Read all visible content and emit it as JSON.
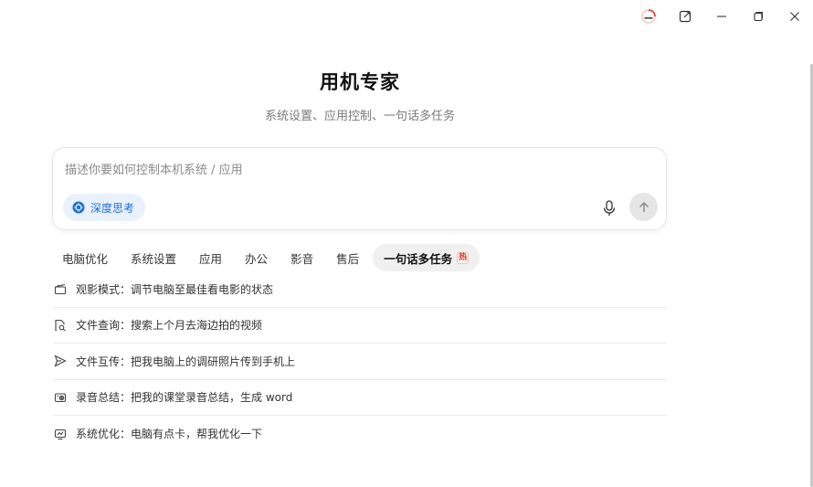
{
  "window": {
    "logo_icon": "app-logo-icon",
    "controls": [
      "pop-out-icon",
      "minimize-icon",
      "maximize-icon",
      "close-icon"
    ]
  },
  "header": {
    "title": "用机专家",
    "subtitle": "系统设置、应用控制、一句话多任务"
  },
  "input": {
    "placeholder": "描述你要如何控制本机系统 / 应用",
    "value": "",
    "deep_think_label": "深度思考",
    "accent": "#1f6fd6"
  },
  "tabs": [
    {
      "label": "电脑优化"
    },
    {
      "label": "系统设置"
    },
    {
      "label": "应用"
    },
    {
      "label": "办公"
    },
    {
      "label": "影音"
    },
    {
      "label": "售后"
    },
    {
      "label": "一句话多任务",
      "badge": "热",
      "active": true
    }
  ],
  "suggestions": [
    {
      "icon": "clapperboard-icon",
      "text": "观影模式：调节电脑至最佳看电影的状态"
    },
    {
      "icon": "file-search-icon",
      "text": "文件查询：搜索上个月去海边拍的视频"
    },
    {
      "icon": "send-icon",
      "text": "文件互传：把我电脑上的调研照片传到手机上"
    },
    {
      "icon": "recorder-icon",
      "text": "录音总结：把我的课堂录音总结，生成 word"
    },
    {
      "icon": "optimize-icon",
      "text": "系统优化：电脑有点卡，帮我优化一下"
    }
  ]
}
